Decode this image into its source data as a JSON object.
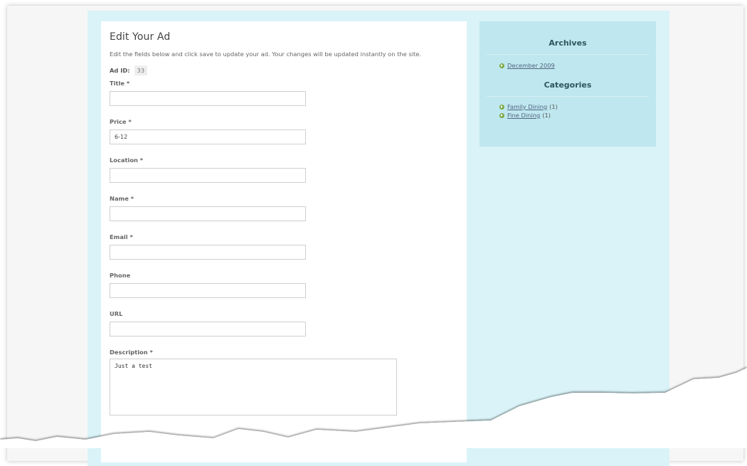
{
  "form": {
    "heading": "Edit Your Ad",
    "intro": "Edit the fields below and click save to update your ad. Your changes will be updated instantly on the site.",
    "ad_id_label": "Ad ID:",
    "ad_id_value": "33",
    "fields": {
      "title": {
        "label": "Title *",
        "value": ""
      },
      "price": {
        "label": "Price *",
        "value": "6-12"
      },
      "location": {
        "label": "Location *",
        "value": ""
      },
      "name": {
        "label": "Name *",
        "value": ""
      },
      "email": {
        "label": "Email *",
        "value": ""
      },
      "phone": {
        "label": "Phone",
        "value": ""
      },
      "url": {
        "label": "URL",
        "value": ""
      },
      "description": {
        "label": "Description *",
        "value": "Just a test"
      }
    }
  },
  "sidebar": {
    "archives_heading": "Archives",
    "archives": [
      {
        "label": "December 2009"
      }
    ],
    "categories_heading": "Categories",
    "categories": [
      {
        "label": "Family Dining",
        "count": "(1)"
      },
      {
        "label": "Fine Dining",
        "count": "(1)"
      }
    ]
  },
  "colors": {
    "frame": "#d9f3f8",
    "sidebar": "#bfe7ef",
    "bullet": "#7aa741",
    "link": "#526680"
  }
}
